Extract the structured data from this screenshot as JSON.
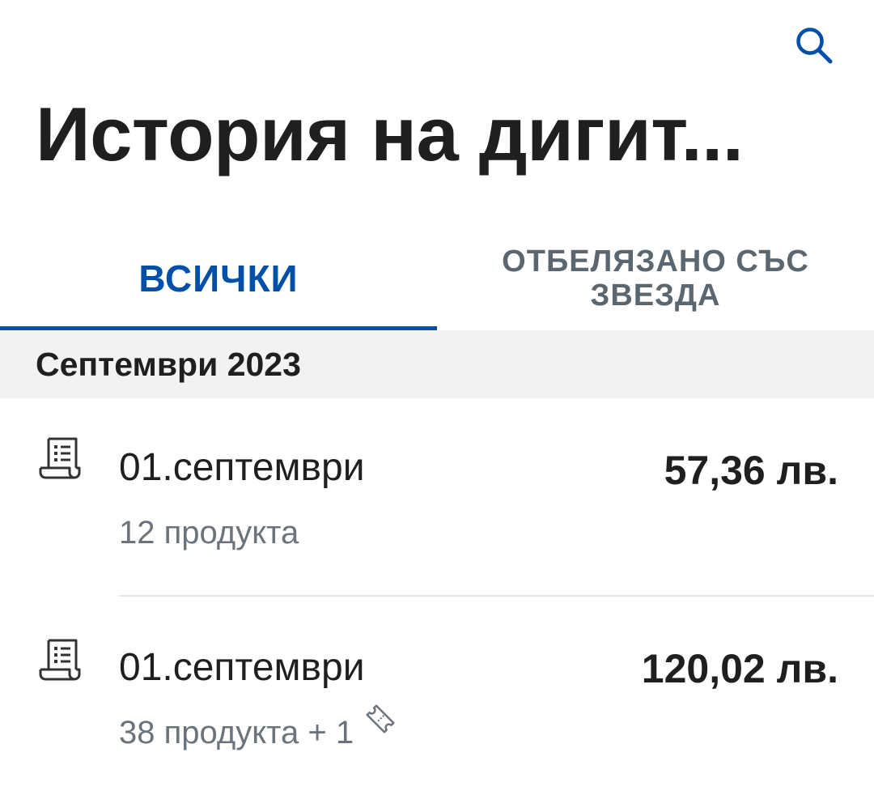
{
  "header": {
    "title": "История на дигит...",
    "search_icon": "search-icon"
  },
  "tabs": [
    {
      "label": "ВСИЧКИ",
      "active": true
    },
    {
      "label": "ОТБЕЛЯЗАНО СЪС ЗВЕЗДА",
      "active": false
    }
  ],
  "colors": {
    "accent": "#0050aa",
    "inactive_tab": "#5a6670",
    "section_bg": "#f2f2f2",
    "subtext": "#6b747c"
  },
  "sections": [
    {
      "title": "Септември 2023",
      "receipts": [
        {
          "icon": "receipt-icon",
          "date": "01.септември",
          "items": "12 продукта",
          "amount": "57,36 лв."
        },
        {
          "icon": "receipt-icon",
          "date": "01.септември",
          "items": "38 продукта + 1",
          "coupon_icon": "coupon-icon",
          "amount": "120,02 лв."
        }
      ]
    }
  ]
}
